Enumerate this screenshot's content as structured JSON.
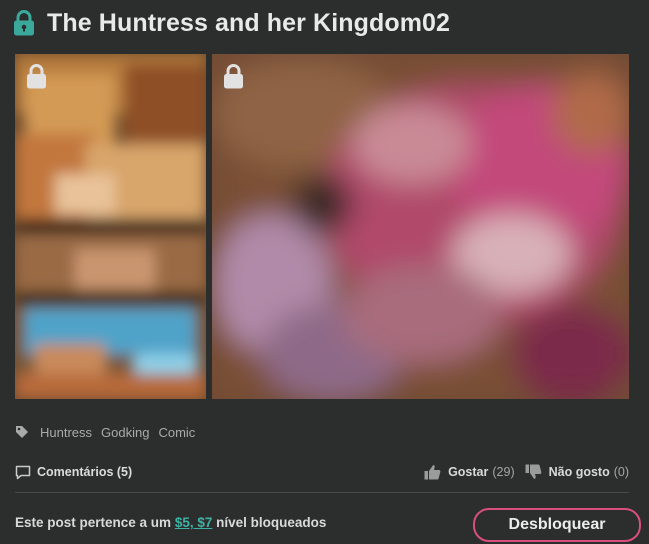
{
  "post": {
    "title": "The Huntress and her Kingdom02",
    "title_lock_color": "#3aa89a"
  },
  "images": [
    {
      "name": "locked-image-1",
      "icon": "lock-icon"
    },
    {
      "name": "locked-image-2",
      "icon": "lock-icon"
    }
  ],
  "tags": [
    "Huntress",
    "Godking",
    "Comic"
  ],
  "stats": {
    "comments_label": "Comentários (5)",
    "like_label": "Gostar",
    "like_count": "(29)",
    "dislike_label": "Não gosto",
    "dislike_count": "(0)"
  },
  "lock_note": {
    "prefix": "Este post pertence a um ",
    "tiers": "$5, $7",
    "suffix": " nível bloqueados"
  },
  "unlock_button": {
    "label": "Desbloquear",
    "border_color": "#d94f7f"
  },
  "colors": {
    "background": "#2c2e2e",
    "accent": "#3db2a3"
  }
}
